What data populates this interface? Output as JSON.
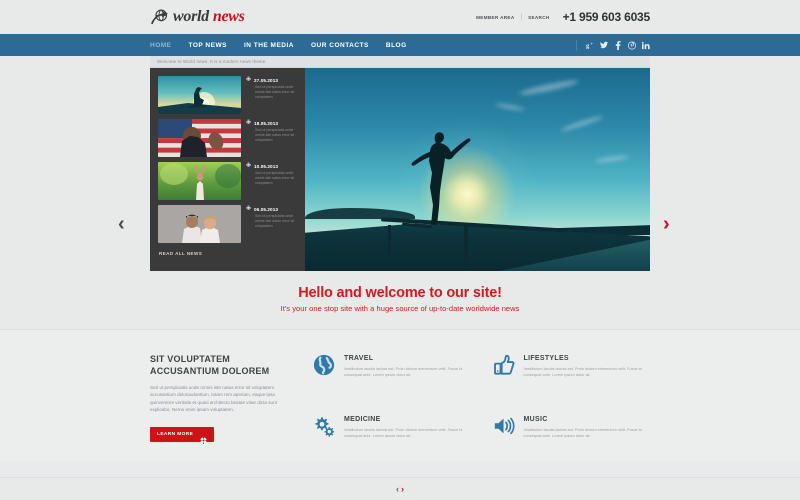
{
  "header": {
    "logo": {
      "icon": "globe-arrow-icon",
      "word1": "world",
      "word2": "news"
    },
    "member_area": "MEMBER AREA",
    "search": "SEARCH",
    "separator": "|",
    "phone": "+1 959 603 6035"
  },
  "nav": {
    "items": [
      {
        "label": "HOME",
        "active": true
      },
      {
        "label": "TOP NEWS",
        "active": false
      },
      {
        "label": "IN THE MEDIA",
        "active": false
      },
      {
        "label": "OUR CONTACTS",
        "active": false
      },
      {
        "label": "BLOG",
        "active": false
      }
    ],
    "socials": [
      {
        "name": "google-plus-icon",
        "glyph": "g+"
      },
      {
        "name": "twitter-icon",
        "glyph": "t"
      },
      {
        "name": "facebook-icon",
        "glyph": "f"
      },
      {
        "name": "pinterest-icon",
        "glyph": "p"
      },
      {
        "name": "linkedin-icon",
        "glyph": "in"
      }
    ]
  },
  "slider": {
    "welcome": "Welcome to World news. It is a modern news theme.",
    "read_all": "READ ALL NEWS",
    "prev_arrow": "‹",
    "next_arrow": "›",
    "bullet": "✙",
    "items": [
      {
        "date": "27.05.2013",
        "text": "Sed ut perspiciatis unde omnis iste natus error sit voluptatem",
        "thumb": "skateboarder-sunset-thumb"
      },
      {
        "date": "18.05.2013",
        "text": "Sed ut perspiciatis unde omnis iste natus error sit voluptatem",
        "thumb": "man-us-flag-thumb"
      },
      {
        "date": "10.05.2013",
        "text": "Sed ut perspiciatis unde omnis iste natus error sit voluptatem",
        "thumb": "dancing-woman-thumb"
      },
      {
        "date": "06.05.2013",
        "text": "Sed ut perspiciatis unde omnis iste natus error sit voluptatem",
        "thumb": "couple-portrait-thumb"
      }
    ],
    "hero_alt": "skateboarder-silhouette-sunset"
  },
  "hello": {
    "title": "Hello and welcome to our site!",
    "subtitle": "It's your one stop site with a huge source of up-to-date worldwide news"
  },
  "about": {
    "heading": "SIT VOLUPTATEM ACCUSANTIUM DOLOREM",
    "body": "Sed ut perspiciatis unde omnis iste natus error sit voluptatem accusantium doloraudantium, totam rem aperiam, eaque ipsa quinventore veritatis et quasi architecto beatae vitae dicta sunt explicabo. Nemo enim ipsam voluptatem.",
    "button": "LEARN MORE",
    "button_icon": "gear-icon"
  },
  "features": [
    {
      "icon": "globe-icon",
      "title": "TRAVEL",
      "text": "Vestibulum iaculis lacinia est. Proin dictum elementum velit. Fusce id consequat ante. Lorem ipsum dolor sit."
    },
    {
      "icon": "thumbs-up-icon",
      "title": "LIFESTYLES",
      "text": "Vestibulum iaculis lacinia est. Proin dictum elementum velit. Fusce id consequat ante. Lorem ipsum dolor sit."
    },
    {
      "icon": "gears-icon",
      "title": "MEDICINE",
      "text": "Vestibulum iaculis lacinia est. Proin dictum elementum velit. Fusce id consequat ante. Lorem ipsum dolor sit."
    },
    {
      "icon": "speaker-icon",
      "title": "MUSIC",
      "text": "Vestibulum iaculis lacinia est. Proin dictum elementum velit. Fusce id consequat ante. Lorem ipsum dolor sit."
    }
  ],
  "footer": {
    "prev": "‹",
    "next": "›"
  },
  "colors": {
    "nav_blue": "#2b6b96",
    "accent_red": "#cc1417",
    "page_bg": "#e8eaea",
    "panel_dark": "#3a3a3a",
    "icon_blue": "#2e7aa8"
  }
}
